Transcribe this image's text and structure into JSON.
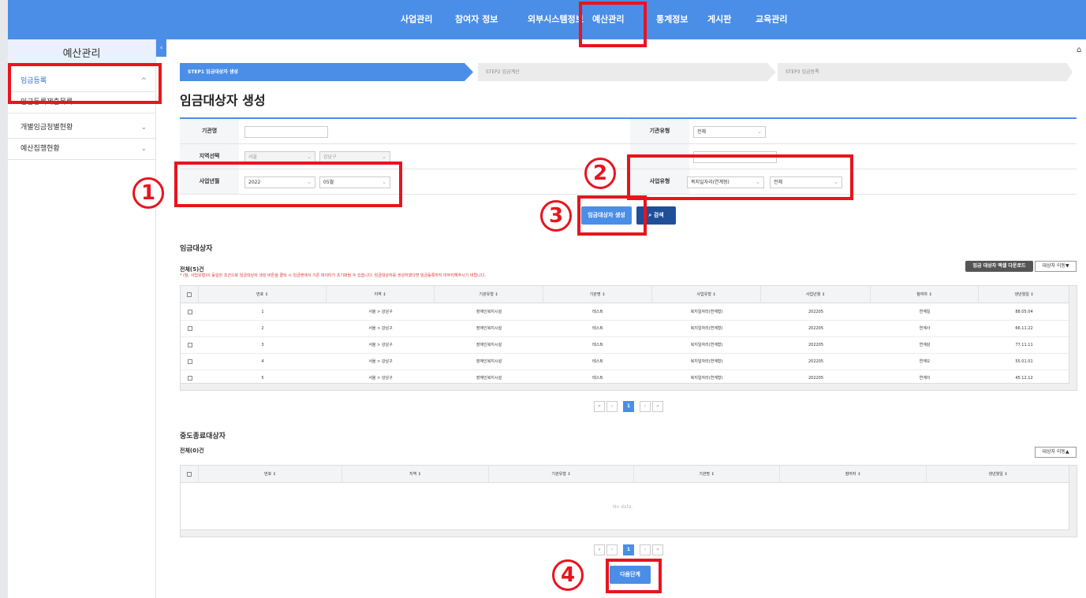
{
  "nav": {
    "items": [
      "사업관리",
      "참여자 정보",
      "외부시스템정보",
      "예산관리",
      "통계정보",
      "게시판",
      "교육관리"
    ]
  },
  "sidebar": {
    "title": "예산관리",
    "toggle": "‹",
    "items": [
      {
        "label": "임금등록",
        "chev": "^"
      },
      {
        "label": "임금등록제출목록",
        "chev": "⌄"
      },
      {
        "label": "개별임금청별현황",
        "chev": "⌄"
      },
      {
        "label": "예산집행현황",
        "chev": "⌄"
      }
    ]
  },
  "home_icon": "⌂",
  "steps": [
    "STEP1 임금대상자 생성",
    "STEP2 임금계산",
    "STEP3 임금등록"
  ],
  "page_title": "임금대상자 생성",
  "form": {
    "org_name_label": "기관명",
    "org_name_value": "",
    "org_type_label": "기관유형",
    "org_type_value": "전체",
    "region_label": "지역선택",
    "region_city": "서울",
    "region_district": "강남구",
    "year_month_label": "사업년월",
    "year_value": "2022",
    "month_value": "05월",
    "biz_type_label": "사업유형",
    "biz_type_value": "복지일자리(연계형)",
    "biz_type_sub": "전체"
  },
  "buttons": {
    "create": "임금대상자 생성",
    "search": "검색",
    "search_icon": "⌕",
    "excel": "임금 대상자 액셀 다운로드",
    "move_down": "대상자 이동▼",
    "move_up": "대상자 이동▲",
    "next": "다음단계"
  },
  "section1": {
    "title": "임금대상자",
    "count": "전체(5)건",
    "notice": "* (참, 사업유형)이 동일한 조건으로 임금대상자 생성 버튼을 클릭 시 임금엔에서 기존 데이터가 초기화될 수 있습니다. 임금대상자를 생성하였다면 임금등록까지 마무리해주시기 바랍니다.",
    "columns": [
      "번호 ↕",
      "지역 ↕",
      "기관유형 ↕",
      "기관명 ↕",
      "사업유형 ↕",
      "사업년월 ↕",
      "참여자 ↕",
      "생년월일 ↕"
    ],
    "rows": [
      [
        "1",
        "서울 > 강남구",
        "장애인복지시설",
        "테스트",
        "복지일자리(연계형)",
        "202205",
        "연계일",
        "88.05.04"
      ],
      [
        "2",
        "서울 > 강남구",
        "장애인복지시설",
        "테스트",
        "복지일자리(연계형)",
        "202205",
        "연계사",
        "66.11.22"
      ],
      [
        "3",
        "서울 > 강남구",
        "장애인복지시설",
        "테스트",
        "복지일자리(연계형)",
        "202205",
        "연계삼",
        "77.11.11"
      ],
      [
        "4",
        "서울 > 강남구",
        "장애인복지시설",
        "테스트",
        "복지일자리(연계형)",
        "202205",
        "연계오",
        "55.01.01"
      ],
      [
        "5",
        "서울 > 강남구",
        "장애인복지시설",
        "테스트",
        "복지일자리(연계형)",
        "202205",
        "연계이",
        "45.12.12"
      ]
    ]
  },
  "section2": {
    "title": "중도종료대상자",
    "count": "전체(0)건",
    "columns": [
      "번호 ↕",
      "지역 ↕",
      "기관유형 ↕",
      "기관명 ↕",
      "참여자 ↕",
      "생년월일 ↕"
    ],
    "no_data": "No data."
  },
  "pager": {
    "first": "«",
    "prev": "‹",
    "current": "1",
    "next": "›",
    "last": "»"
  },
  "annotations": [
    "1",
    "2",
    "3",
    "4"
  ]
}
